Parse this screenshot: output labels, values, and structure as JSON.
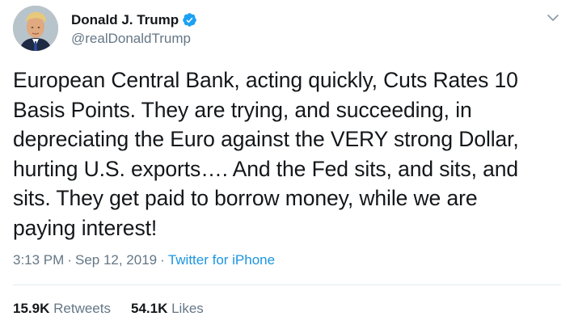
{
  "author": {
    "display_name": "Donald J. Trump",
    "handle": "@realDonaldTrump",
    "verified": true
  },
  "icons": {
    "verified": "verified-badge-icon",
    "menu": "chevron-down-icon"
  },
  "tweet": {
    "lines": [
      "European Central Bank, acting quickly, Cuts Rates 10",
      "Basis Points. They are trying, and succeeding, in",
      "depreciating the Euro against the VERY strong Dollar,",
      "hurting U.S. exports…. And the Fed sits, and sits, and",
      "sits. They get paid to borrow money, while we are",
      "paying interest!"
    ]
  },
  "meta": {
    "time": "3:13 PM",
    "separator": "·",
    "date": "Sep 12, 2019",
    "source": "Twitter for iPhone"
  },
  "stats": {
    "retweets_count": "15.9K",
    "retweets_label": "Retweets",
    "likes_count": "54.1K",
    "likes_label": "Likes"
  },
  "colors": {
    "accent": "#1b95e0",
    "verified": "#1da1f2",
    "secondary_text": "#657786",
    "primary_text": "#14171a",
    "divider": "#e6ecf0"
  }
}
